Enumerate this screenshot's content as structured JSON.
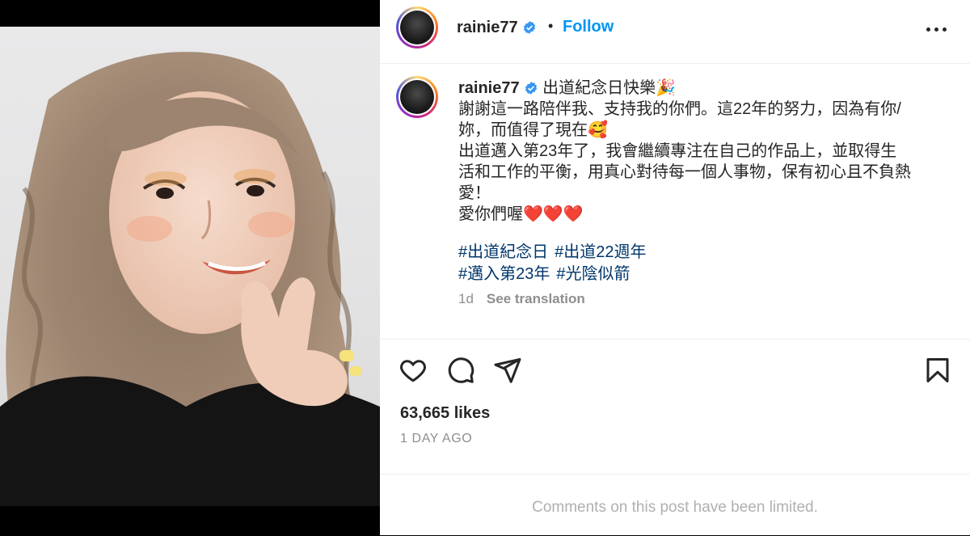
{
  "post": {
    "username": "rainie77",
    "follow_label": "Follow",
    "dot": "•",
    "caption_lines": [
      "出道紀念日快樂🎉",
      "謝謝這一路陪伴我、支持我的你們。這22年的努力，因為有你/",
      "妳，而值得了現在🥰",
      "出道邁入第23年了，我會繼續專注在自己的作品上，並取得生",
      "活和工作的平衡，用真心對待每一個人事物，保有初心且不負熱",
      "愛！",
      "愛你們喔❤️❤️❤️"
    ],
    "hashtags": [
      "#出道紀念日",
      "#出道22週年",
      "#邁入第23年",
      "#光陰似箭"
    ],
    "time_short": "1d",
    "see_translation": "See translation",
    "likes": "63,665 likes",
    "time_long": "1 DAY AGO",
    "comments_notice": "Comments on this post have been limited."
  },
  "colors": {
    "link_blue": "#0095f6",
    "hashtag_blue": "#00376b",
    "muted": "#8e8e8e",
    "verified_blue": "#3897f0"
  },
  "icons": [
    "verified-badge-icon",
    "more-options-icon",
    "heart-icon",
    "comment-icon",
    "share-icon",
    "bookmark-icon"
  ]
}
